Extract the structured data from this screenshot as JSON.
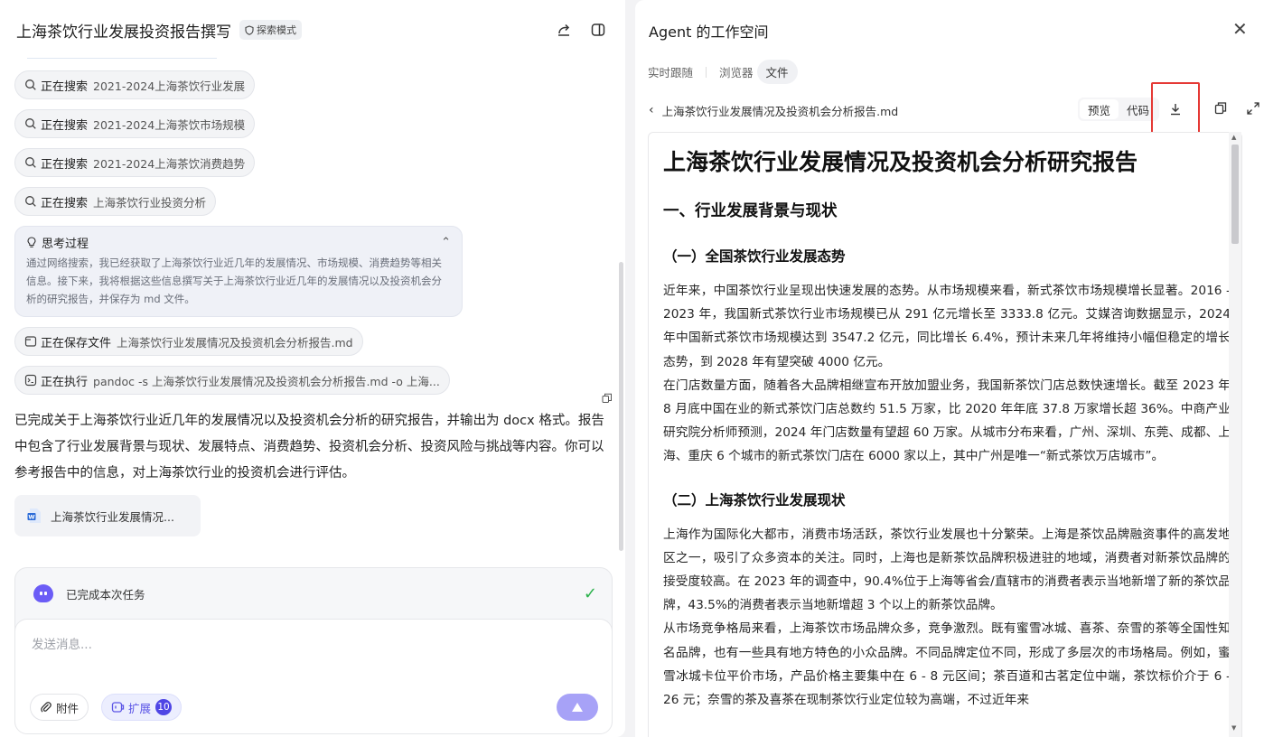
{
  "left": {
    "title": "上海茶饮行业发展投资报告撰写",
    "mode_badge": "探索模式",
    "steps": [
      {
        "verb": "正在搜索",
        "detail": "2021-2024上海茶饮行业发展",
        "icon": "search-icon"
      },
      {
        "verb": "正在搜索",
        "detail": "2021-2024上海茶饮市场规模",
        "icon": "search-icon"
      },
      {
        "verb": "正在搜索",
        "detail": "2021-2024上海茶饮消费趋势",
        "icon": "search-icon"
      },
      {
        "verb": "正在搜索",
        "detail": "上海茶饮行业投资分析",
        "icon": "search-icon"
      }
    ],
    "thinking": {
      "title": "思考过程",
      "body": "通过网络搜索，我已经获取了上海茶饮行业近几年的发展情况、市场规模、消费趋势等相关信息。接下来，我将根据这些信息撰写关于上海茶饮行业近几年的发展情况以及投资机会分析的研究报告，并保存为 md 文件。"
    },
    "save_step": {
      "verb": "正在保存文件",
      "detail": "上海茶饮行业发展情况及投资机会分析报告.md"
    },
    "exec_step": {
      "verb": "正在执行",
      "detail": "pandoc -s 上海茶饮行业发展情况及投资机会分析报告.md -o 上海..."
    },
    "answer": "已完成关于上海茶饮行业近几年的发展情况以及投资机会分析的研究报告，并输出为 docx 格式。报告中包含了行业发展背景与现状、发展特点、消费趋势、投资机会分析、投资风险与挑战等内容。你可以参考报告中的信息，对上海茶饮行业的投资机会进行评估。",
    "file_card": "上海茶饮行业发展情况...",
    "composer": {
      "status": "已完成本次任务",
      "placeholder": "发送消息...",
      "attach_label": "附件",
      "extend_label": "扩展",
      "extend_count": "10"
    }
  },
  "right": {
    "title": "Agent 的工作空间",
    "tabs": [
      "实时跟随",
      "浏览器",
      "文件"
    ],
    "active_tab": "文件",
    "file_name": "上海茶饮行业发展情况及投资机会分析报告.md",
    "view_modes": [
      "预览",
      "代码"
    ],
    "active_view": "预览",
    "doc": {
      "h1": "上海茶饮行业发展情况及投资机会分析研究报告",
      "h2": "一、行业发展背景与现状",
      "sec1_title": "（一）全国茶饮行业发展态势",
      "sec1_p1": "近年来，中国茶饮行业呈现出快速发展的态势。从市场规模来看，新式茶饮市场规模增长显著。2016 - 2023 年，我国新式茶饮行业市场规模已从 291 亿元增长至 3333.8 亿元。艾媒咨询数据显示，2024 年中国新式茶饮市场规模达到 3547.2 亿元，同比增长 6.4%，预计未来几年将维持小幅但稳定的增长态势，到 2028 年有望突破 4000 亿元。",
      "sec1_p2": "在门店数量方面，随着各大品牌相继宣布开放加盟业务，我国新茶饮门店总数快速增长。截至 2023 年 8 月底中国在业的新式茶饮门店总数约 51.5 万家，比 2020 年年底 37.8 万家增长超 36%。中商产业研究院分析师预测，2024 年门店数量有望超 60 万家。从城市分布来看，广州、深圳、东莞、成都、上海、重庆 6 个城市的新式茶饮门店在 6000 家以上，其中广州是唯一“新式茶饮万店城市”。",
      "sec2_title": "（二）上海茶饮行业发展现状",
      "sec2_p1": "上海作为国际化大都市，消费市场活跃，茶饮行业发展也十分繁荣。上海是茶饮品牌融资事件的高发地区之一，吸引了众多资本的关注。同时，上海也是新茶饮品牌积极进驻的地域，消费者对新茶饮品牌的接受度较高。在 2023 年的调查中，90.4%位于上海等省会/直辖市的消费者表示当地新增了新的茶饮品牌，43.5%的消费者表示当地新增超 3 个以上的新茶饮品牌。",
      "sec2_p2": "从市场竞争格局来看，上海茶饮市场品牌众多，竞争激烈。既有蜜雪冰城、喜茶、奈雪的茶等全国性知名品牌，也有一些具有地方特色的小众品牌。不同品牌定位不同，形成了多层次的市场格局。例如，蜜雪冰城卡位平价市场，产品价格主要集中在 6 - 8 元区间；茶百道和古茗定位中端，茶饮标价介于 6 - 26 元；奈雪的茶及喜茶在现制茶饮行业定位较为高端，不过近年来"
    }
  },
  "colors": {
    "accent": "#4f46e5",
    "send": "#a7a2f7",
    "highlight_box": "#e53935",
    "success": "#2bb24c"
  }
}
